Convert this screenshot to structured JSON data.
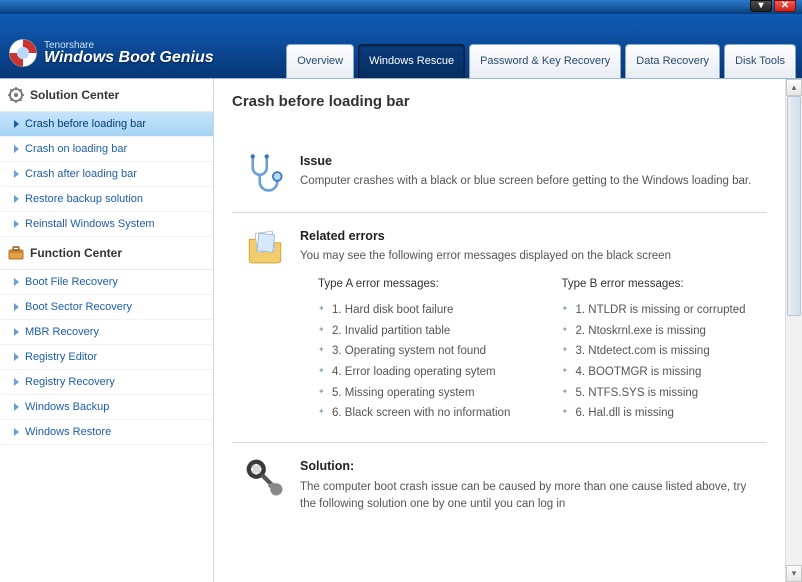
{
  "brand": {
    "vendor": "Tenorshare",
    "product": "Windows Boot Genius"
  },
  "tabs": [
    {
      "label": "Overview"
    },
    {
      "label": "Windows Rescue"
    },
    {
      "label": "Password & Key Recovery"
    },
    {
      "label": "Data Recovery"
    },
    {
      "label": "Disk Tools"
    }
  ],
  "activeTab": 1,
  "sidebar": {
    "solution": {
      "title": "Solution Center",
      "items": [
        "Crash before loading bar",
        "Crash on loading bar",
        "Crash after loading bar",
        "Restore backup solution",
        "Reinstall Windows System"
      ],
      "selectedIndex": 0
    },
    "function": {
      "title": "Function Center",
      "items": [
        "Boot File Recovery",
        "Boot Sector Recovery",
        "MBR Recovery",
        "Registry Editor",
        "Registry Recovery",
        "Windows Backup",
        "Windows Restore"
      ]
    }
  },
  "page": {
    "title": "Crash before loading bar",
    "issue": {
      "heading": "Issue",
      "text": "Computer crashes with a black or blue screen before getting to the Windows loading bar."
    },
    "related": {
      "heading": "Related errors",
      "intro": "You may see the following error messages displayed on the black screen",
      "colA": {
        "title": "Type A error messages:",
        "items": [
          "1. Hard disk boot failure",
          "2. Invalid partition table",
          "3. Operating system not found",
          "4. Error loading operating sytem",
          "5. Missing operating system",
          "6. Black screen with no information"
        ]
      },
      "colB": {
        "title": "Type B error messages:",
        "items": [
          "1. NTLDR is missing or corrupted",
          "2. Ntoskrnl.exe is missing",
          "3. Ntdetect.com is missing",
          "4. BOOTMGR is missing",
          "5. NTFS.SYS is missing",
          "6. Hal.dll is missing"
        ]
      }
    },
    "solution": {
      "heading": "Solution:",
      "text": "The computer boot crash issue can be caused by more than one cause listed above, try the following solution one by one until you can log in"
    }
  }
}
